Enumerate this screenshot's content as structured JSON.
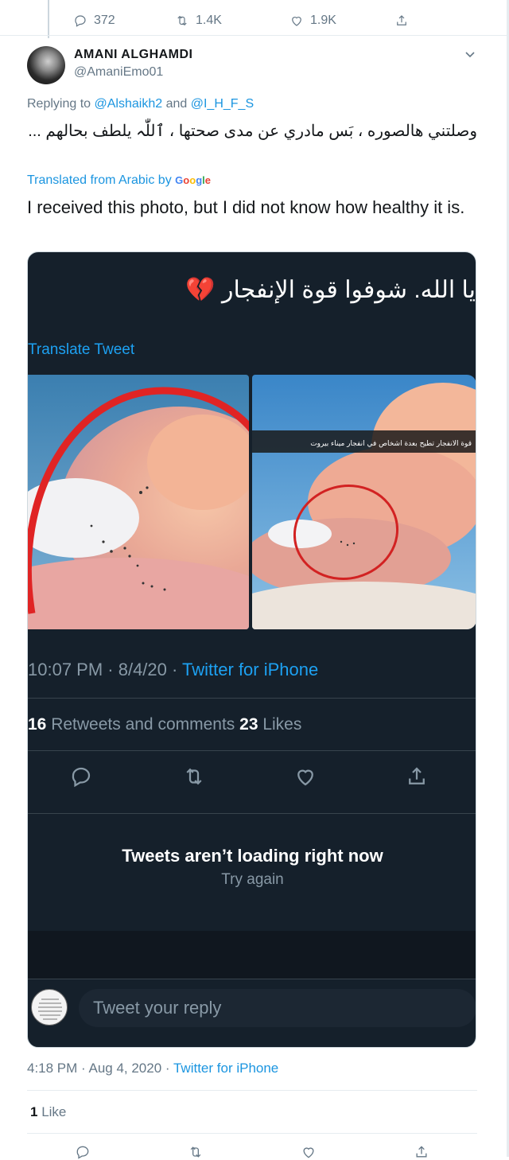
{
  "top_actions": {
    "replies": "372",
    "retweets": "1.4K",
    "likes": "1.9K"
  },
  "author": {
    "name": "AMANI ALGHAMDI",
    "handle": "@AmaniEmo01"
  },
  "replying": {
    "prefix": "Replying to",
    "user1": "@Alshaikh2",
    "and": "and",
    "user2": "@I_H_F_S"
  },
  "tweet": {
    "text_arabic": "وصلتني هالصوره ، بَس مادري عن مدى صحتها ، ٱللّٰہ يلطف بحالهم ...",
    "translated_label": "Translated from Arabic by",
    "google_letters": [
      "G",
      "o",
      "o",
      "g",
      "l",
      "e"
    ],
    "translation": "I received this photo, but I did not know how healthy it is."
  },
  "embedded": {
    "arabic_text": "يا الله. شوفوا قوة الإنفجار",
    "heart": "💔",
    "translate_label": "Translate Tweet",
    "photo_caption_arabic": "قوة الانفجار تطيح بعدة اشخاص في انفجار ميناء بيروت",
    "time": "10:07 PM · 8/4/20 · ",
    "source": "Twitter for iPhone",
    "retweets_count": "16",
    "retweets_label": " Retweets and comments ",
    "likes_count": "23",
    "likes_label": " Likes",
    "error_title": "Tweets aren’t loading right now",
    "error_retry": "Try again",
    "reply_placeholder": "Tweet your reply"
  },
  "meta": {
    "time": "4:18 PM · Aug 4, 2020 · ",
    "source": "Twitter for iPhone"
  },
  "likes": {
    "count": "1",
    "label": " Like"
  }
}
